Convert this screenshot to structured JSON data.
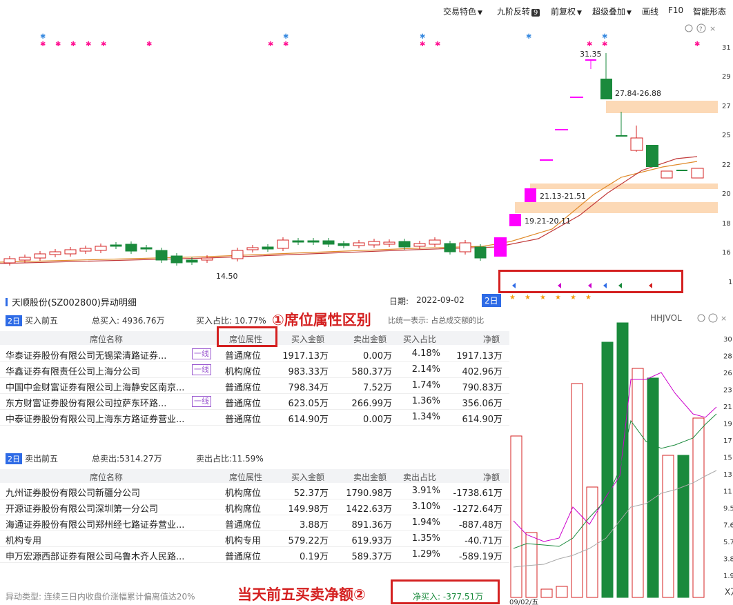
{
  "toolbar": {
    "items": [
      "交易特色",
      "九阶反转",
      "前复权",
      "超级叠加",
      "画线",
      "F10",
      "智能形态"
    ],
    "jiujie_badge": "9"
  },
  "price_axis": {
    "labels": [
      "31",
      "29",
      "27",
      "25",
      "22",
      "20",
      "18",
      "16",
      "1"
    ]
  },
  "kline_labels": {
    "high": "31.35",
    "low": "14.50",
    "zone1": "27.84-26.88",
    "zone2": "21.13-21.51",
    "zone3": "19.21-20.11"
  },
  "panel": {
    "title": "天顺股份(SZ002800)异动明细",
    "date_label": "日期:",
    "date_value": "2022-09-02",
    "period_tag": "2日",
    "buy": {
      "tag": "2日",
      "title": "买入前五",
      "total_label": "总买入: 4936.76万",
      "ratio_label": "买入占比: 10.77%",
      "note": "比统一表示: 占总成交额的比"
    },
    "columns": [
      "席位名称",
      "席位属性",
      "买入金额",
      "卖出金额",
      "买入占比",
      "净额"
    ],
    "sell_columns": [
      "席位名称",
      "席位属性",
      "买入金额",
      "卖出金额",
      "卖出占比",
      "净额"
    ],
    "buy_rows": [
      {
        "name": "华泰证券股份有限公司无锡梁清路证券...",
        "tag": "一线",
        "attr": "普通席位",
        "buy": "1917.13万",
        "sell": "0.00万",
        "ratio": "4.18%",
        "net": "1917.13万"
      },
      {
        "name": "华鑫证券有限责任公司上海分公司",
        "tag": "一线",
        "attr": "机构席位",
        "buy": "983.33万",
        "sell": "580.37万",
        "ratio": "2.14%",
        "net": "402.96万"
      },
      {
        "name": "中国中金财富证券有限公司上海静安区南京...",
        "tag": "",
        "attr": "普通席位",
        "buy": "798.34万",
        "sell": "7.52万",
        "ratio": "1.74%",
        "net": "790.83万"
      },
      {
        "name": "东方财富证券股份有限公司拉萨东环路...",
        "tag": "一线",
        "attr": "普通席位",
        "buy": "623.05万",
        "sell": "266.99万",
        "ratio": "1.36%",
        "net": "356.06万"
      },
      {
        "name": "中泰证券股份有限公司上海东方路证券营业...",
        "tag": "",
        "attr": "普通席位",
        "buy": "614.90万",
        "sell": "0.00万",
        "ratio": "1.34%",
        "net": "614.90万"
      }
    ],
    "sell": {
      "tag": "2日",
      "title": "卖出前五",
      "total_label": "总卖出:5314.27万",
      "ratio_label": "卖出占比:11.59%"
    },
    "sell_rows": [
      {
        "name": "九州证券股份有限公司新疆分公司",
        "attr": "机构席位",
        "buy": "52.37万",
        "sell": "1790.98万",
        "ratio": "3.91%",
        "net": "-1738.61万"
      },
      {
        "name": "开源证券股份有限公司深圳第一分公司",
        "attr": "机构席位",
        "buy": "149.98万",
        "sell": "1422.63万",
        "ratio": "3.10%",
        "net": "-1272.64万"
      },
      {
        "name": "海通证券股份有限公司郑州经七路证券营业...",
        "attr": "普通席位",
        "buy": "3.88万",
        "sell": "891.36万",
        "ratio": "1.94%",
        "net": "-887.48万"
      },
      {
        "name": "机构专用",
        "attr": "机构专用",
        "buy": "579.22万",
        "sell": "619.93万",
        "ratio": "1.35%",
        "net": "-40.71万"
      },
      {
        "name": "申万宏源西部证券有限公司乌鲁木齐人民路...",
        "attr": "普通席位",
        "buy": "0.19万",
        "sell": "589.37万",
        "ratio": "1.29%",
        "net": "-589.19万"
      }
    ],
    "footer_type": "异动类型: 连续三日内收盘价涨幅累计偏离值达20%",
    "net_buy": "净买入: -377.51万"
  },
  "annotations": {
    "a1": "①席位属性区别",
    "a2": "当天前五买卖净额②"
  },
  "vol": {
    "title": "HHJVOL",
    "labels": [
      "30",
      "28",
      "26",
      "23",
      "21",
      "19",
      "17",
      "15",
      "13",
      "11",
      "9.5",
      "7.6",
      "5.7",
      "3.8",
      "1.9"
    ],
    "unit": "X万",
    "date_stub": "09/02/五"
  },
  "colors": {
    "up": "#d42020",
    "down": "#1a8a3c",
    "accent": "#2e6be6",
    "zone": "#fcd9b6",
    "magenta": "#ff00ff"
  }
}
